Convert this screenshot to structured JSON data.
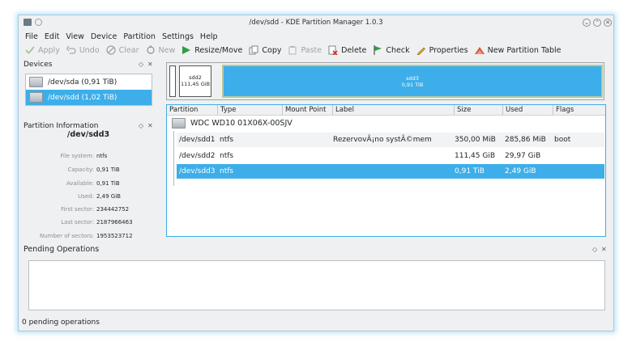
{
  "window": {
    "title": "/dev/sdd - KDE Partition Manager 1.0.3",
    "buttons": [
      "⌄",
      "⌃",
      "✕"
    ]
  },
  "menu": [
    "File",
    "Edit",
    "View",
    "Device",
    "Partition",
    "Settings",
    "Help"
  ],
  "toolbar": {
    "apply": "Apply",
    "undo": "Undo",
    "clear": "Clear",
    "new": "New",
    "resize": "Resize/Move",
    "copy": "Copy",
    "paste": "Paste",
    "delete": "Delete",
    "check": "Check",
    "properties": "Properties",
    "new_table": "New Partition Table"
  },
  "devices": {
    "title": "Devices",
    "items": [
      {
        "label": "/dev/sda (0,91 TiB)",
        "selected": false
      },
      {
        "label": "/dev/sdd (1,02 TiB)",
        "selected": true
      }
    ]
  },
  "partition_info": {
    "title": "Partition Information",
    "device": "/dev/sdd3",
    "rows": [
      {
        "key": "File system:",
        "value": "ntfs"
      },
      {
        "key": "Capacity:",
        "value": "0,91 TiB"
      },
      {
        "key": "Available:",
        "value": "0,91 TiB"
      },
      {
        "key": "Used:",
        "value": "2,49 GiB"
      },
      {
        "key": "First sector:",
        "value": "234442752"
      },
      {
        "key": "Last sector:",
        "value": "2187966463"
      },
      {
        "key": "Number of sectors:",
        "value": "1953523712"
      }
    ]
  },
  "graph": {
    "sdd2_name": "sdd2",
    "sdd2_size": "111,45 GiB",
    "sdd3_name": "sdd3",
    "sdd3_size": "0,91 TiB"
  },
  "table": {
    "headers": [
      "Partition",
      "Type",
      "Mount Point",
      "Label",
      "Size",
      "Used",
      "Flags"
    ],
    "disk": "WDC WD10 01X06X-00SJV",
    "rows": [
      {
        "partition": "/dev/sdd1",
        "type": "ntfs",
        "mount": "",
        "label": "RezervovÃ¡no systÃ©mem",
        "size": "350,00 MiB",
        "used": "285,86 MiB",
        "flags": "boot"
      },
      {
        "partition": "/dev/sdd2",
        "type": "ntfs",
        "mount": "",
        "label": "",
        "size": "111,45 GiB",
        "used": "29,97 GiB",
        "flags": ""
      },
      {
        "partition": "/dev/sdd3",
        "type": "ntfs",
        "mount": "",
        "label": "",
        "size": "0,91 TiB",
        "used": "2,49 GiB",
        "flags": ""
      }
    ]
  },
  "pending": {
    "title": "Pending Operations",
    "status": "0 pending operations"
  },
  "colors": {
    "accent": "#3daee9",
    "window_bg": "#eff0f1"
  }
}
